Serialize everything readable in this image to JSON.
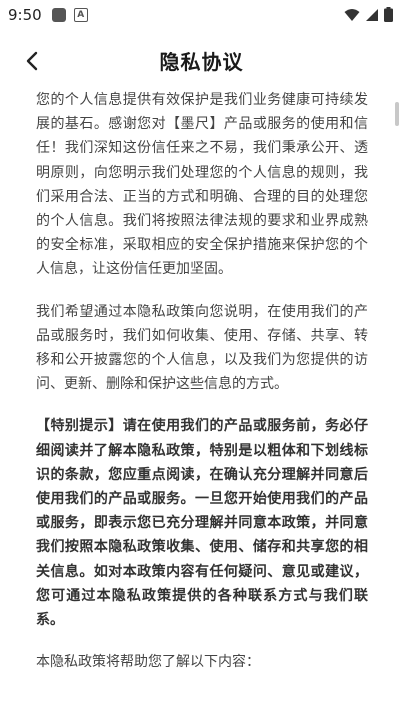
{
  "status": {
    "time": "9:50"
  },
  "header": {
    "title": "隐私协议"
  },
  "content": {
    "p1": "您的个人信息提供有效保护是我们业务健康可持续发展的基石。感谢您对【墨尺】产品或服务的使用和信任！我们深知这份信任来之不易，我们秉承公开、透明原则，向您明示我们处理您的个人信息的规则，我们采用合法、正当的方式和明确、合理的目的处理您的个人信息。我们将按照法律法规的要求和业界成熟的安全标准，采取相应的安全保护措施来保护您的个人信息，让这份信任更加坚固。",
    "p2": "我们希望通过本隐私政策向您说明，在使用我们的产品或服务时，我们如何收集、使用、存储、共享、转移和公开披露您的个人信息，以及我们为您提供的访问、更新、删除和保护这些信息的方式。",
    "p3": "【特别提示】请在使用我们的产品或服务前，务必仔细阅读并了解本隐私政策，特别是以粗体和下划线标识的条款，您应重点阅读，在确认充分理解并同意后使用我们的产品或服务。一旦您开始使用我们的产品或服务，即表示您已充分理解并同意本政策，并同意我们按照本隐私政策收集、使用、储存和共享您的相关信息。如对本政策内容有任何疑问、意见或建议，您可通过本隐私政策提供的各种联系方式与我们联系。",
    "p4": "本隐私政策将帮助您了解以下内容："
  }
}
